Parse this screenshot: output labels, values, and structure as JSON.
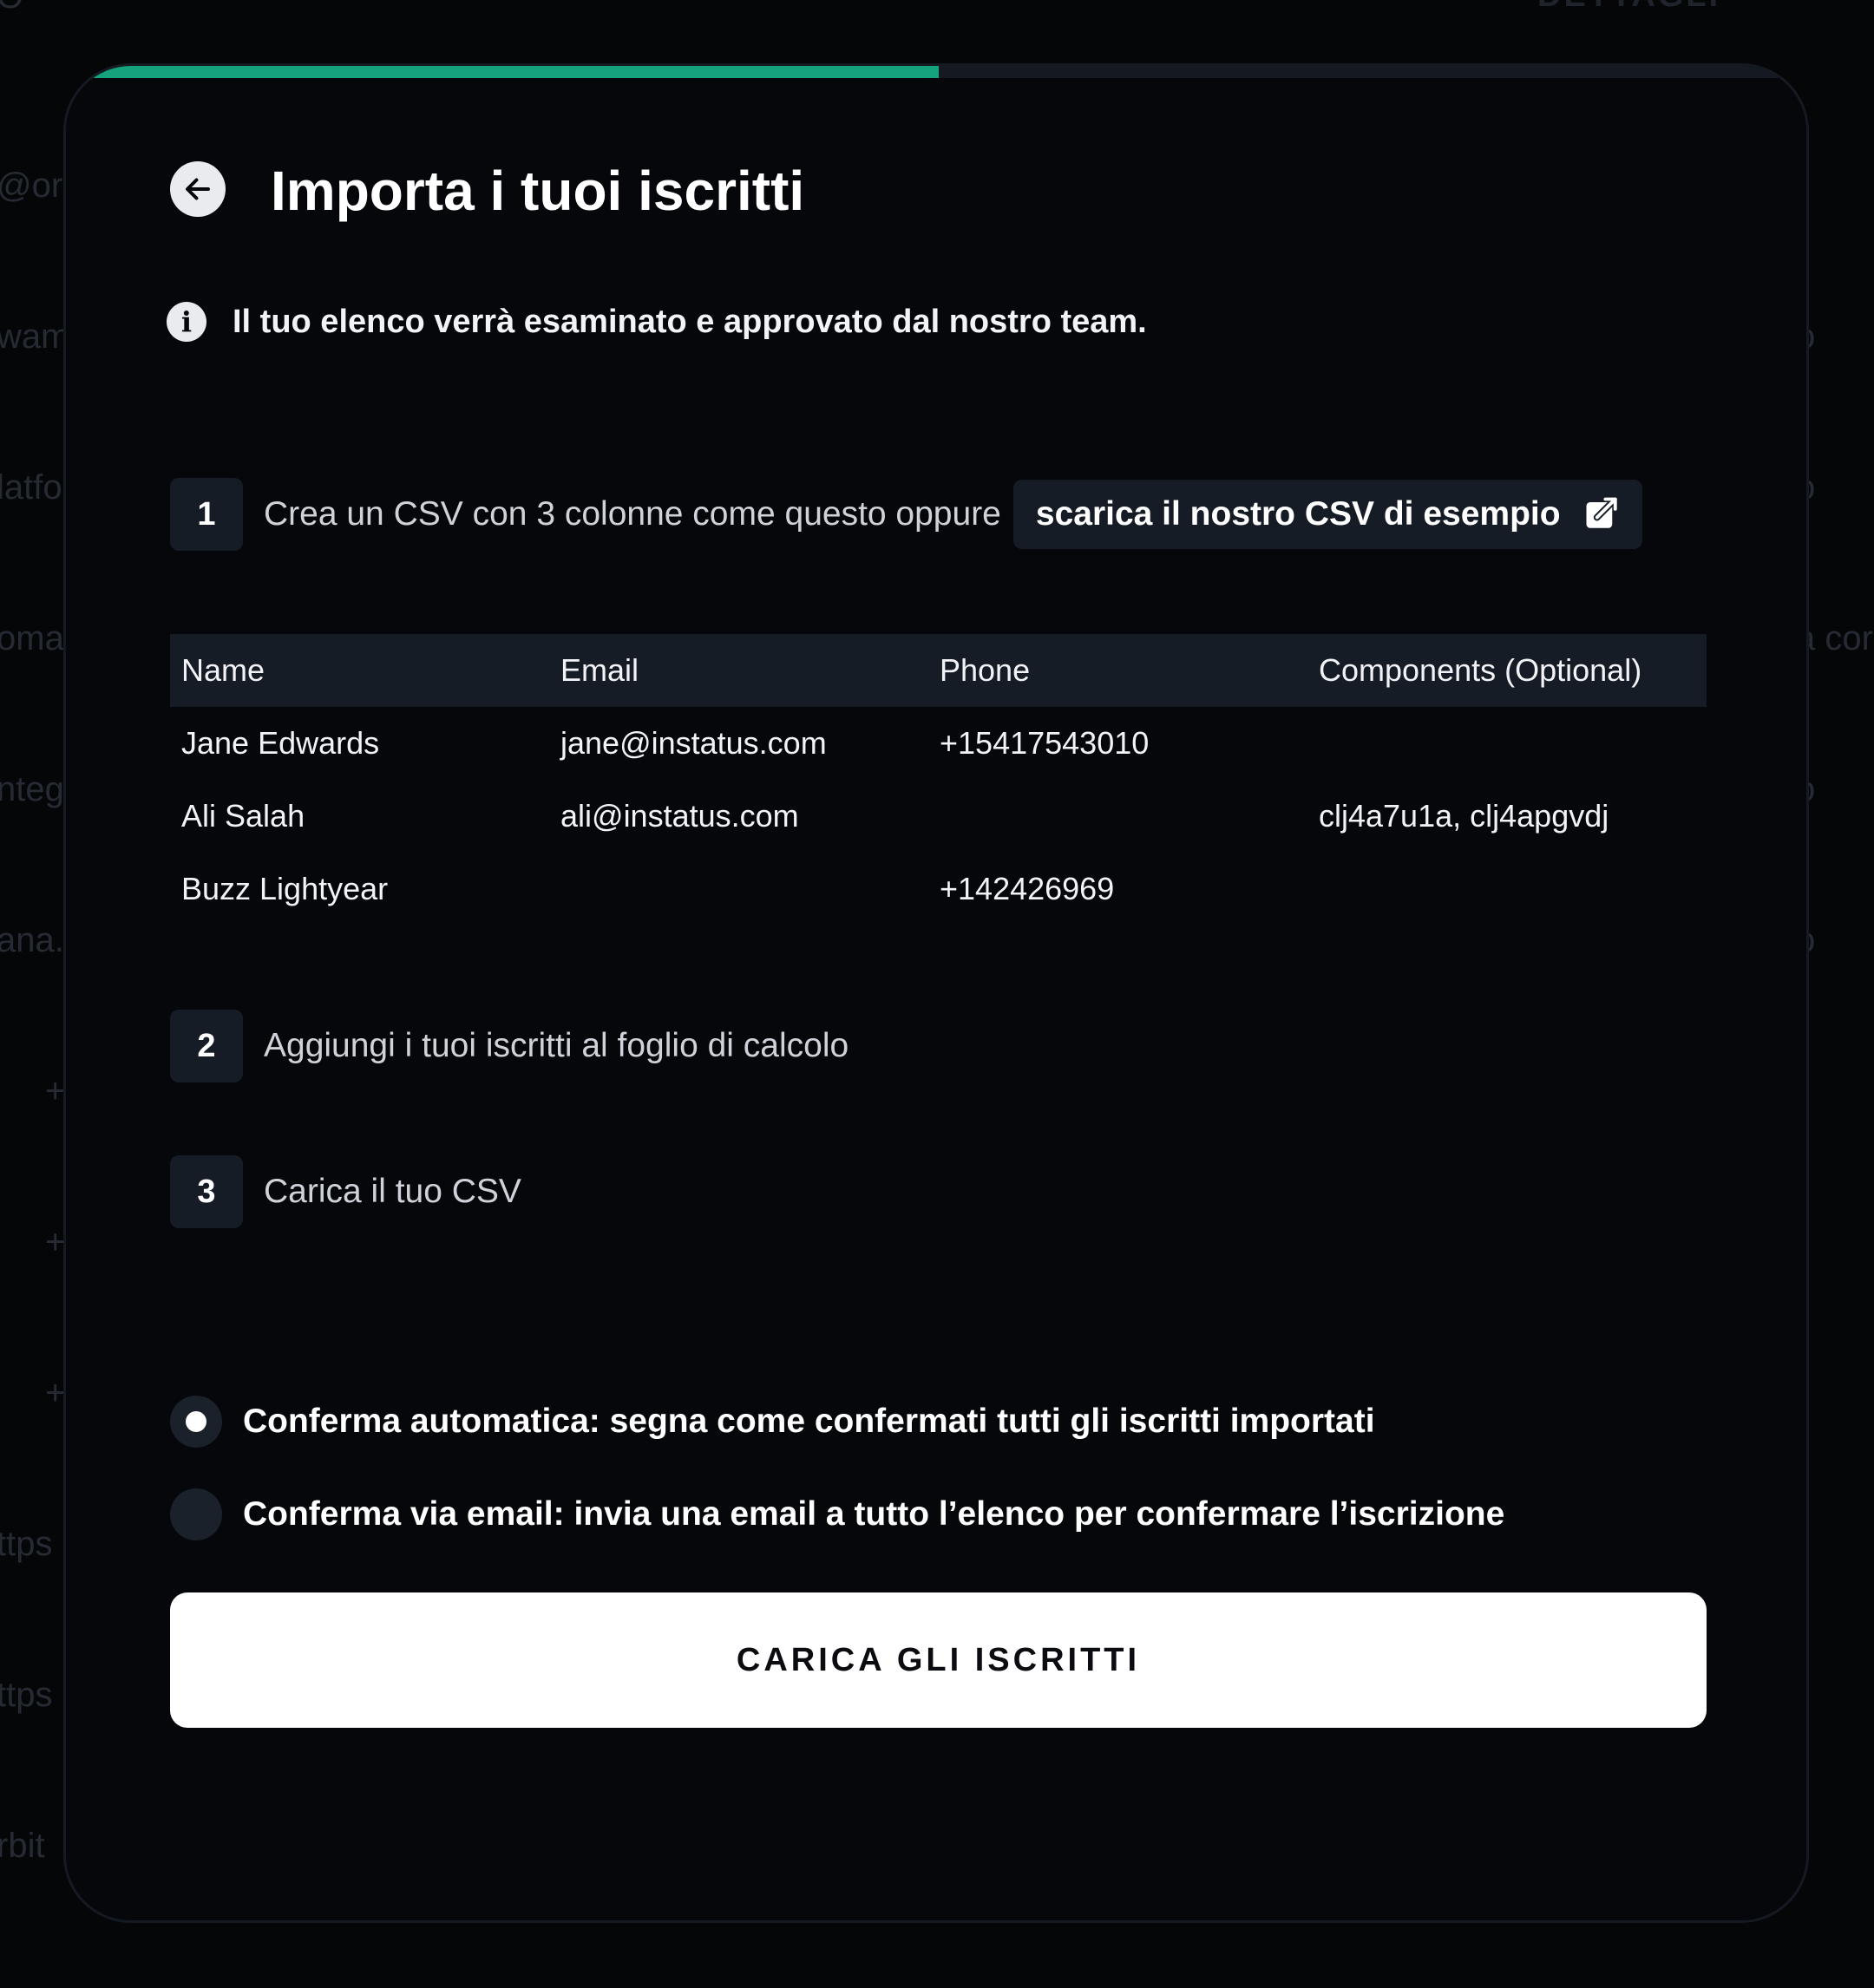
{
  "background": {
    "title": "DETTAGLI",
    "left_fragments": [
      "O",
      "@orb",
      "wam",
      "latfo",
      "oma",
      "nteg",
      "ana.",
      "+",
      "+",
      "+",
      "ttps",
      "ttps",
      "rbit"
    ],
    "right_fragments": [
      "o",
      "o",
      "a cor",
      "o",
      "o"
    ]
  },
  "modal": {
    "progress_fraction": 0.5,
    "title": "Importa i tuoi iscritti",
    "info_text": "Il tuo elenco verrà esaminato e approvato dal nostro team.",
    "steps": [
      {
        "number": "1",
        "text": "Crea un CSV con 3 colonne come questo oppure",
        "link_label": "scarica il nostro CSV di esempio"
      },
      {
        "number": "2",
        "text": "Aggiungi i tuoi iscritti al foglio di calcolo"
      },
      {
        "number": "3",
        "text": "Carica il tuo CSV"
      }
    ],
    "table": {
      "headers": [
        "Name",
        "Email",
        "Phone",
        "Components (Optional)"
      ],
      "rows": [
        [
          "Jane Edwards",
          "jane@instatus.com",
          "+15417543010",
          ""
        ],
        [
          "Ali Salah",
          "ali@instatus.com",
          "",
          "clj4a7u1a, clj4apgvdj"
        ],
        [
          "Buzz Lightyear",
          "",
          "+142426969",
          ""
        ]
      ]
    },
    "options": [
      {
        "label": "Conferma automatica: segna come confermati tutti gli iscritti importati",
        "selected": true
      },
      {
        "label": "Conferma via email: invia una email a tutto l’elenco per confermare l’iscrizione",
        "selected": false
      }
    ],
    "submit_label": "CARICA GLI ISCRITTI"
  },
  "colors": {
    "background": "#050608",
    "modal": "#05070b",
    "accent": "#15a37e",
    "chip": "#161c26",
    "button": "#ffffff"
  },
  "icons": {
    "back": "arrow-left-icon",
    "info": "info-icon",
    "external": "external-link-icon"
  }
}
